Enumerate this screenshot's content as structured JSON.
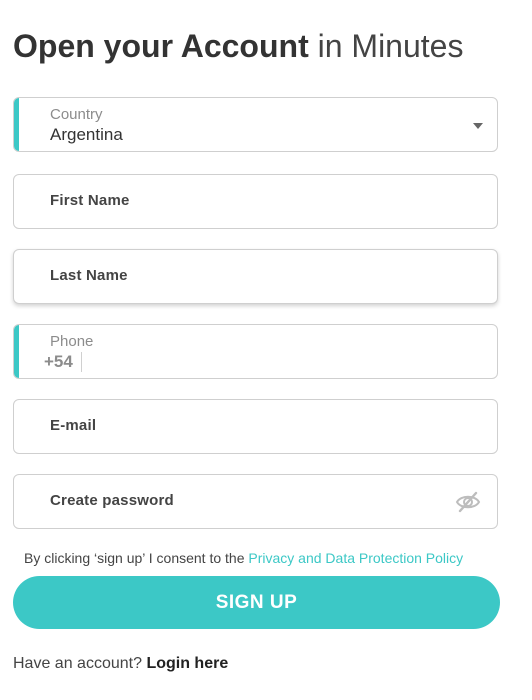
{
  "title": {
    "bold": "Open your Account",
    "light": "in Minutes"
  },
  "form": {
    "country": {
      "label": "Country",
      "value": "Argentina"
    },
    "first_name": {
      "label": "First Name"
    },
    "last_name": {
      "label": "Last Name"
    },
    "phone": {
      "label": "Phone",
      "prefix": "+54"
    },
    "email": {
      "label": "E-mail"
    },
    "password": {
      "label": "Create password",
      "toggle_icon": "eye-slash-icon"
    }
  },
  "consent": {
    "text": "By clicking ‘sign up’ I consent to the",
    "link": "Privacy and Data Protection Policy"
  },
  "signup_button": "SIGN UP",
  "login": {
    "prompt": "Have an account?",
    "link": "Login here"
  },
  "colors": {
    "accent": "#3cc8c6",
    "text": "#333333",
    "muted": "#8c8c8c",
    "border": "#cfcfcf"
  }
}
